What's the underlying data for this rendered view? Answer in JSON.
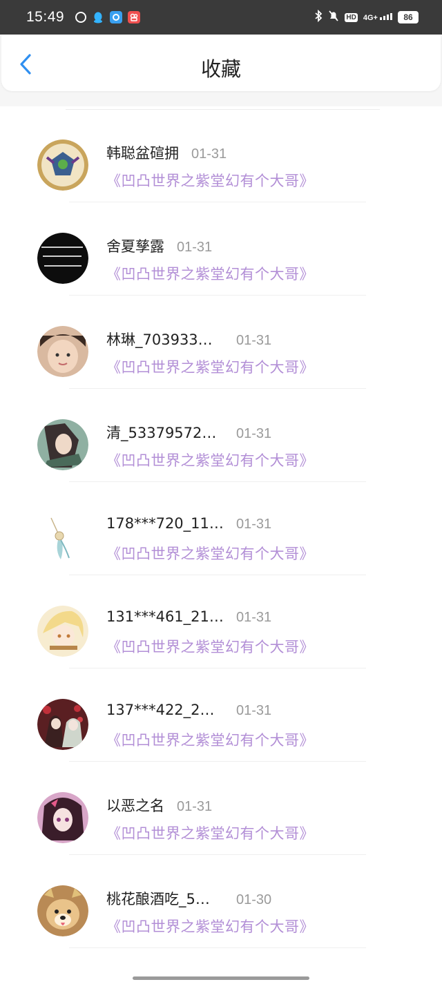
{
  "status_bar": {
    "time": "15:49",
    "network": "4G+",
    "hd": "HD",
    "battery": "86"
  },
  "header": {
    "title": "收藏",
    "back_icon": "chevron-left-icon"
  },
  "favorites": [
    {
      "name": "韩聪盆碹拥",
      "date": "01-31",
      "work": "《凹凸世界之紫堂幻有个大哥》",
      "avatar_color": "#c9a55c"
    },
    {
      "name": "舍夏孳露",
      "date": "01-31",
      "work": "《凹凸世界之紫堂幻有个大哥》",
      "avatar_color": "#111111"
    },
    {
      "name": "林琳_703933…",
      "date": "01-31",
      "work": "《凹凸世界之紫堂幻有个大哥》",
      "avatar_color": "#e8c4a8"
    },
    {
      "name": "清_53379572…",
      "date": "01-31",
      "work": "《凹凸世界之紫堂幻有个大哥》",
      "avatar_color": "#7a9a8c"
    },
    {
      "name": "178***720_11…",
      "date": "01-31",
      "work": "《凹凸世界之紫堂幻有个大哥》",
      "avatar_color": "#f2f2f2"
    },
    {
      "name": "131***461_21…",
      "date": "01-31",
      "work": "《凹凸世界之紫堂幻有个大哥》",
      "avatar_color": "#f3e4b8"
    },
    {
      "name": "137***422_2…",
      "date": "01-31",
      "work": "《凹凸世界之紫堂幻有个大哥》",
      "avatar_color": "#7a2a2a"
    },
    {
      "name": "以恶之名",
      "date": "01-31",
      "work": "《凹凸世界之紫堂幻有个大哥》",
      "avatar_color": "#6a3a7a"
    },
    {
      "name": "桃花酿酒吃_5…",
      "date": "01-30",
      "work": "《凹凸世界之紫堂幻有个大哥》",
      "avatar_color": "#c8945a"
    }
  ],
  "colors": {
    "accent_blue": "#2f8ff0",
    "work_title_purple": "#b28ed6",
    "status_bar_bg": "#3a3a3a"
  }
}
